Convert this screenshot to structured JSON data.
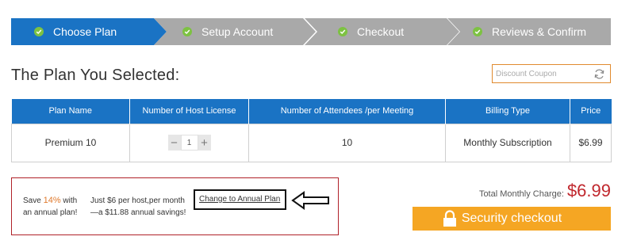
{
  "steps": [
    {
      "label": "Choose Plan",
      "state": "active"
    },
    {
      "label": "Setup Account",
      "state": "inactive"
    },
    {
      "label": "Checkout",
      "state": "inactive"
    },
    {
      "label": "Reviews & Confirm",
      "state": "inactive"
    }
  ],
  "page_title": "The Plan You Selected:",
  "coupon": {
    "placeholder": "Discount Coupon",
    "value": ""
  },
  "table": {
    "headers": [
      "Plan Name",
      "Number of Host License",
      "Number of Attendees /per Meeting",
      "Billing Type",
      "Price"
    ],
    "row": {
      "plan_name": "Premium 10",
      "host_license_qty": "1",
      "attendees": "10",
      "billing_type": "Monthly Subscription",
      "price": "$6.99"
    },
    "stepper_minus": "−",
    "stepper_plus": "+"
  },
  "offer": {
    "save_prefix": "Save",
    "save_percent": "14%",
    "save_suffix": "with an annual plan!",
    "desc_line1": "Just $6 per host,per month",
    "desc_line2": "—a $11.88 annual savings!",
    "link": "Change to Annual Plan"
  },
  "totals": {
    "label": "Total Monthly Charge:",
    "amount": "$6.99"
  },
  "checkout": {
    "label": "Security checkout"
  },
  "colors": {
    "primary_blue": "#1a73c4",
    "step_inactive": "#a9a9a9",
    "check_green": "#7dc242",
    "price_red": "#c0272d",
    "accent_orange": "#f5a623",
    "coupon_border": "#e08a2e"
  },
  "icons": {
    "step_check": "check-circle-icon",
    "coupon_refresh": "refresh-icon",
    "annotation_arrow": "arrow-left-icon",
    "checkout_lock": "lock-icon"
  }
}
